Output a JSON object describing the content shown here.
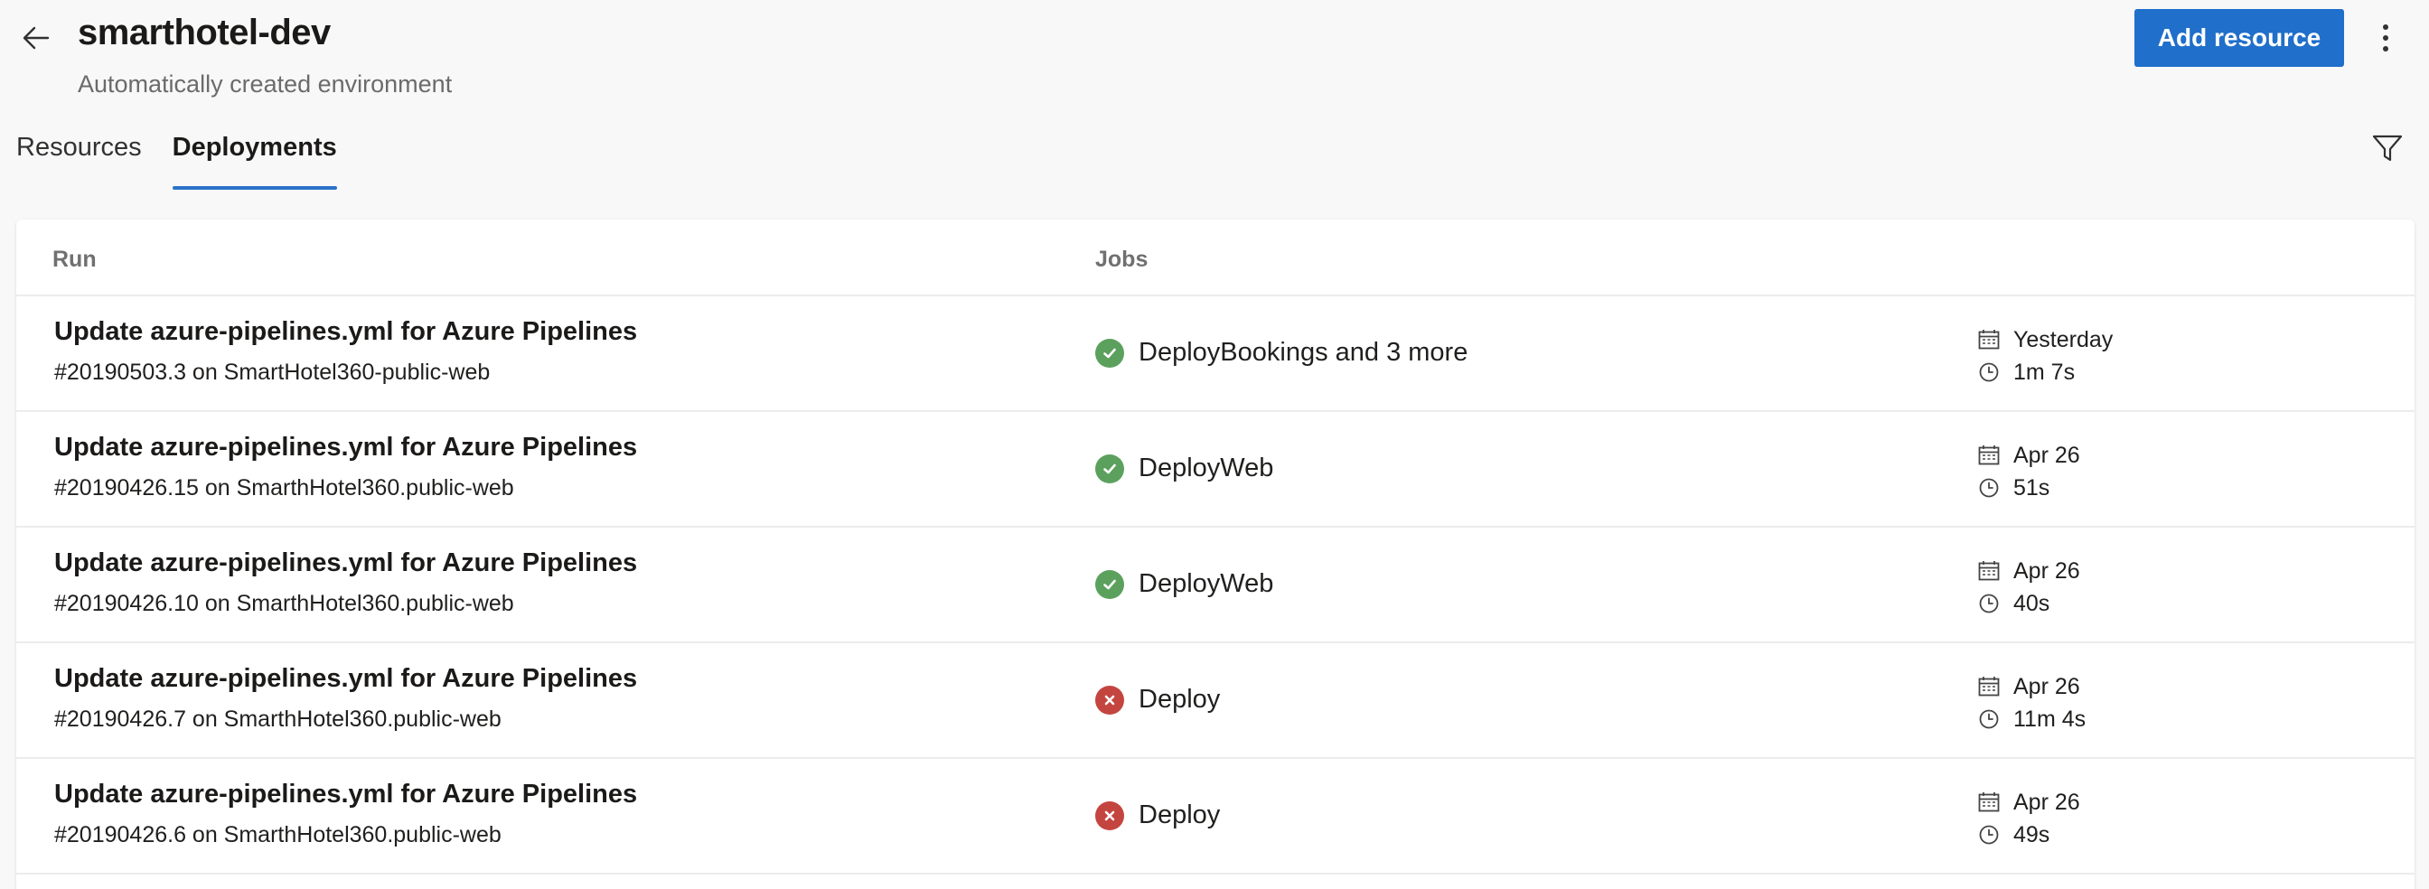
{
  "header": {
    "title": "smarthotel-dev",
    "subtitle": "Automatically created environment",
    "add_resource_label": "Add resource",
    "back_icon": "arrow-left-icon",
    "more_icon": "more-vertical-icon"
  },
  "tabs": [
    {
      "label": "Resources",
      "active": false
    },
    {
      "label": "Deployments",
      "active": true
    }
  ],
  "filter_icon": "filter-icon",
  "table": {
    "columns": {
      "run": "Run",
      "jobs": "Jobs"
    },
    "rows": [
      {
        "title": "Update azure-pipelines.yml for Azure Pipelines",
        "subtitle": "#20190503.3 on SmartHotel360-public-web",
        "status": "succeeded",
        "job": "DeployBookings and 3 more",
        "date": "Yesterday",
        "duration": "1m 7s"
      },
      {
        "title": "Update azure-pipelines.yml for Azure Pipelines",
        "subtitle": "#20190426.15 on SmarthHotel360.public-web",
        "status": "succeeded",
        "job": "DeployWeb",
        "date": "Apr 26",
        "duration": "51s"
      },
      {
        "title": "Update azure-pipelines.yml for Azure Pipelines",
        "subtitle": "#20190426.10 on SmarthHotel360.public-web",
        "status": "succeeded",
        "job": "DeployWeb",
        "date": "Apr 26",
        "duration": "40s"
      },
      {
        "title": "Update azure-pipelines.yml for Azure Pipelines",
        "subtitle": "#20190426.7 on SmarthHotel360.public-web",
        "status": "failed",
        "job": "Deploy",
        "date": "Apr 26",
        "duration": "11m 4s"
      },
      {
        "title": "Update azure-pipelines.yml for Azure Pipelines",
        "subtitle": "#20190426.6 on SmarthHotel360.public-web",
        "status": "failed",
        "job": "Deploy",
        "date": "Apr 26",
        "duration": "49s"
      }
    ]
  },
  "colors": {
    "accent": "#1f6fcb",
    "success": "#5ba15d",
    "failure": "#c4453f"
  }
}
